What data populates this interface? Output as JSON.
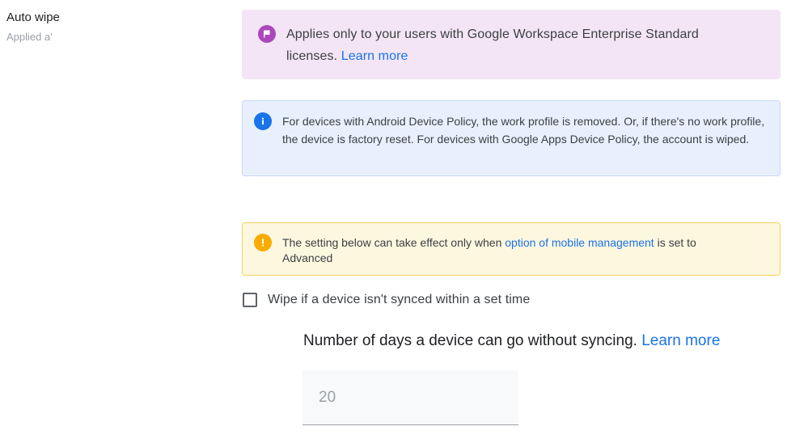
{
  "setting": {
    "title": "Auto wipe",
    "subtitle": "Applied a'"
  },
  "banners": {
    "enterprise": {
      "icon": "flag-icon",
      "text": "Applies only to your users with Google Workspace Enterprise Standard licenses. ",
      "link": "Learn more",
      "color": "#f3e5f5"
    },
    "info": {
      "icon": "info-icon",
      "text": "For devices with Android Device Policy, the work profile is removed. Or, if there's no work profile, the device is factory reset. For devices with Google Apps Device Policy, the account is wiped.",
      "color": "#e8f0fe"
    },
    "warning": {
      "icon": "warning-icon",
      "text_before": "The setting below can take effect only when ",
      "link": "option of mobile management",
      "text_after": " is set to Advanced",
      "color": "#fef7e0"
    }
  },
  "wipe_option": {
    "label": "Wipe if a device isn't synced within a set time",
    "checked": false
  },
  "days": {
    "heading": "Number of days a device can go without syncing. ",
    "link": "Learn more",
    "value": "",
    "placeholder": "20"
  },
  "colors": {
    "link": "#1a73e8"
  }
}
